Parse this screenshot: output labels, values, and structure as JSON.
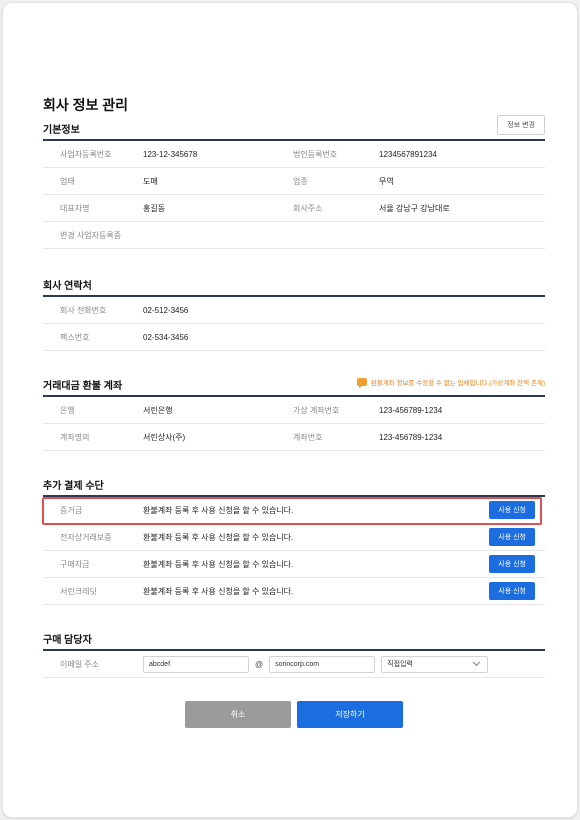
{
  "page_title": "회사 정보 관리",
  "basic": {
    "title": "기본정보",
    "edit_label": "정보 변경",
    "rows": [
      {
        "l1": "사업자등록번호",
        "v1": "123-12-345678",
        "l2": "법인등록번호",
        "v2": "1234567891234"
      },
      {
        "l1": "업태",
        "v1": "도매",
        "l2": "업종",
        "v2": "무역"
      },
      {
        "l1": "대표자명",
        "v1": "홍길동",
        "l2": "회사주소",
        "v2": "서울 강남구 강남대로"
      }
    ],
    "change_label": "변경 사업자등록증"
  },
  "contact": {
    "title": "회사 연락처",
    "rows": [
      {
        "label": "회사 전화번호",
        "value": "02-512-3456"
      },
      {
        "label": "팩스번호",
        "value": "02-534-3456"
      }
    ]
  },
  "refund": {
    "title": "거래대금 환불 계좌",
    "notice": "환불계좌 정보를 수정할 수 없는 업체입니다.(가상계좌 잔액 존재)",
    "rows": [
      {
        "l1": "은행",
        "v1": "서린은행",
        "l2": "가상 계좌번호",
        "v2": "123-456789-1234"
      },
      {
        "l1": "계좌명의",
        "v1": "서린상사(주)",
        "l2": "계좌번호",
        "v2": "123-456789-1234"
      }
    ]
  },
  "payment": {
    "title": "추가 결제 수단",
    "apply_label": "사용 신청",
    "rows": [
      {
        "label": "증거금",
        "desc": "환불계좌 등록 후 사용 신청을 할 수 있습니다."
      },
      {
        "label": "전자상거래보증",
        "desc": "환불계좌 등록 후 사용 신청을 할 수 있습니다."
      },
      {
        "label": "구매자금",
        "desc": "환불계좌 등록 후 사용 신청을 할 수 있습니다."
      },
      {
        "label": "서린크레딧",
        "desc": "환불계좌 등록 후 사용 신청을 할 수 있습니다."
      }
    ]
  },
  "buyer": {
    "title": "구매 담당자",
    "email_label": "이메일 주소",
    "email_id": "abcdef",
    "at": "@",
    "email_domain": "sorincorp.com",
    "domain_select": "직접입력"
  },
  "buttons": {
    "cancel": "취소",
    "save": "저장하기"
  },
  "colors": {
    "primary": "#1c6ee0",
    "header_line": "#2b3a52",
    "notice": "#e8821c",
    "highlight": "#e05050"
  }
}
